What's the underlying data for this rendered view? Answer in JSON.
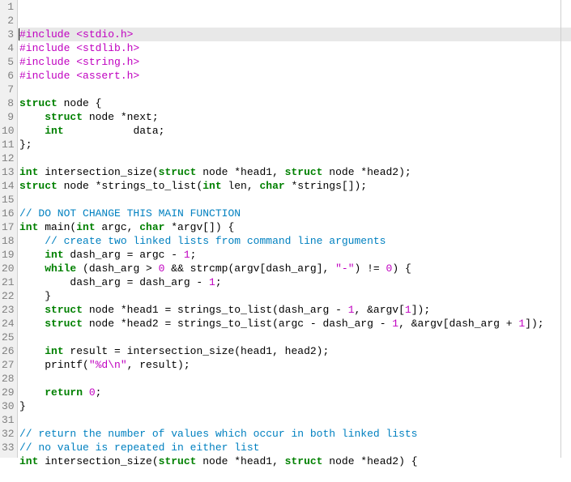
{
  "editor": {
    "line_count": 33,
    "highlighted_line": 1,
    "lines": [
      {
        "n": 1,
        "tokens": [
          [
            "pp",
            "#include "
          ],
          [
            "inc",
            "<stdio.h>"
          ]
        ]
      },
      {
        "n": 2,
        "tokens": [
          [
            "pp",
            "#include "
          ],
          [
            "inc",
            "<stdlib.h>"
          ]
        ]
      },
      {
        "n": 3,
        "tokens": [
          [
            "pp",
            "#include "
          ],
          [
            "inc",
            "<string.h>"
          ]
        ]
      },
      {
        "n": 4,
        "tokens": [
          [
            "pp",
            "#include "
          ],
          [
            "inc",
            "<assert.h>"
          ]
        ]
      },
      {
        "n": 5,
        "tokens": []
      },
      {
        "n": 6,
        "tokens": [
          [
            "kw",
            "struct"
          ],
          [
            "pn",
            " node {"
          ]
        ]
      },
      {
        "n": 7,
        "tokens": [
          [
            "pn",
            "    "
          ],
          [
            "kw",
            "struct"
          ],
          [
            "pn",
            " node *next;"
          ]
        ]
      },
      {
        "n": 8,
        "tokens": [
          [
            "pn",
            "    "
          ],
          [
            "ty",
            "int"
          ],
          [
            "pn",
            "           data;"
          ]
        ]
      },
      {
        "n": 9,
        "tokens": [
          [
            "pn",
            "};"
          ]
        ]
      },
      {
        "n": 10,
        "tokens": []
      },
      {
        "n": 11,
        "tokens": [
          [
            "ty",
            "int"
          ],
          [
            "pn",
            " intersection_size("
          ],
          [
            "kw",
            "struct"
          ],
          [
            "pn",
            " node *head1, "
          ],
          [
            "kw",
            "struct"
          ],
          [
            "pn",
            " node *head2);"
          ]
        ]
      },
      {
        "n": 12,
        "tokens": [
          [
            "kw",
            "struct"
          ],
          [
            "pn",
            " node *strings_to_list("
          ],
          [
            "ty",
            "int"
          ],
          [
            "pn",
            " len, "
          ],
          [
            "ty",
            "char"
          ],
          [
            "pn",
            " *strings[]);"
          ]
        ]
      },
      {
        "n": 13,
        "tokens": []
      },
      {
        "n": 14,
        "tokens": [
          [
            "cm",
            "// DO NOT CHANGE THIS MAIN FUNCTION"
          ]
        ]
      },
      {
        "n": 15,
        "tokens": [
          [
            "ty",
            "int"
          ],
          [
            "pn",
            " main("
          ],
          [
            "ty",
            "int"
          ],
          [
            "pn",
            " argc, "
          ],
          [
            "ty",
            "char"
          ],
          [
            "pn",
            " *argv[]) {"
          ]
        ]
      },
      {
        "n": 16,
        "tokens": [
          [
            "pn",
            "    "
          ],
          [
            "cm",
            "// create two linked lists from command line arguments"
          ]
        ]
      },
      {
        "n": 17,
        "tokens": [
          [
            "pn",
            "    "
          ],
          [
            "ty",
            "int"
          ],
          [
            "pn",
            " dash_arg = argc - "
          ],
          [
            "num",
            "1"
          ],
          [
            "pn",
            ";"
          ]
        ]
      },
      {
        "n": 18,
        "tokens": [
          [
            "pn",
            "    "
          ],
          [
            "kw",
            "while"
          ],
          [
            "pn",
            " (dash_arg > "
          ],
          [
            "num",
            "0"
          ],
          [
            "pn",
            " && strcmp(argv[dash_arg], "
          ],
          [
            "str",
            "\"-\""
          ],
          [
            "pn",
            ") != "
          ],
          [
            "num",
            "0"
          ],
          [
            "pn",
            ") {"
          ]
        ]
      },
      {
        "n": 19,
        "tokens": [
          [
            "pn",
            "        dash_arg = dash_arg - "
          ],
          [
            "num",
            "1"
          ],
          [
            "pn",
            ";"
          ]
        ]
      },
      {
        "n": 20,
        "tokens": [
          [
            "pn",
            "    }"
          ]
        ]
      },
      {
        "n": 21,
        "tokens": [
          [
            "pn",
            "    "
          ],
          [
            "kw",
            "struct"
          ],
          [
            "pn",
            " node *head1 = strings_to_list(dash_arg - "
          ],
          [
            "num",
            "1"
          ],
          [
            "pn",
            ", &argv["
          ],
          [
            "num",
            "1"
          ],
          [
            "pn",
            "]);"
          ]
        ]
      },
      {
        "n": 22,
        "tokens": [
          [
            "pn",
            "    "
          ],
          [
            "kw",
            "struct"
          ],
          [
            "pn",
            " node *head2 = strings_to_list(argc - dash_arg - "
          ],
          [
            "num",
            "1"
          ],
          [
            "pn",
            ", &argv[dash_arg + "
          ],
          [
            "num",
            "1"
          ],
          [
            "pn",
            "]);"
          ]
        ]
      },
      {
        "n": 23,
        "tokens": []
      },
      {
        "n": 24,
        "tokens": [
          [
            "pn",
            "    "
          ],
          [
            "ty",
            "int"
          ],
          [
            "pn",
            " result = intersection_size(head1, head2);"
          ]
        ]
      },
      {
        "n": 25,
        "tokens": [
          [
            "pn",
            "    printf("
          ],
          [
            "str",
            "\"%d\\n\""
          ],
          [
            "pn",
            ", result);"
          ]
        ]
      },
      {
        "n": 26,
        "tokens": []
      },
      {
        "n": 27,
        "tokens": [
          [
            "pn",
            "    "
          ],
          [
            "kw",
            "return"
          ],
          [
            "pn",
            " "
          ],
          [
            "num",
            "0"
          ],
          [
            "pn",
            ";"
          ]
        ]
      },
      {
        "n": 28,
        "tokens": [
          [
            "pn",
            "}"
          ]
        ]
      },
      {
        "n": 29,
        "tokens": []
      },
      {
        "n": 30,
        "tokens": [
          [
            "cm",
            "// return the number of values which occur in both linked lists"
          ]
        ]
      },
      {
        "n": 31,
        "tokens": [
          [
            "cm",
            "// no value is repeated in either list"
          ]
        ]
      },
      {
        "n": 32,
        "tokens": [
          [
            "ty",
            "int"
          ],
          [
            "pn",
            " intersection_size("
          ],
          [
            "kw",
            "struct"
          ],
          [
            "pn",
            " node *head1, "
          ],
          [
            "kw",
            "struct"
          ],
          [
            "pn",
            " node *head2) {"
          ]
        ]
      },
      {
        "n": 33,
        "tokens": []
      }
    ]
  }
}
